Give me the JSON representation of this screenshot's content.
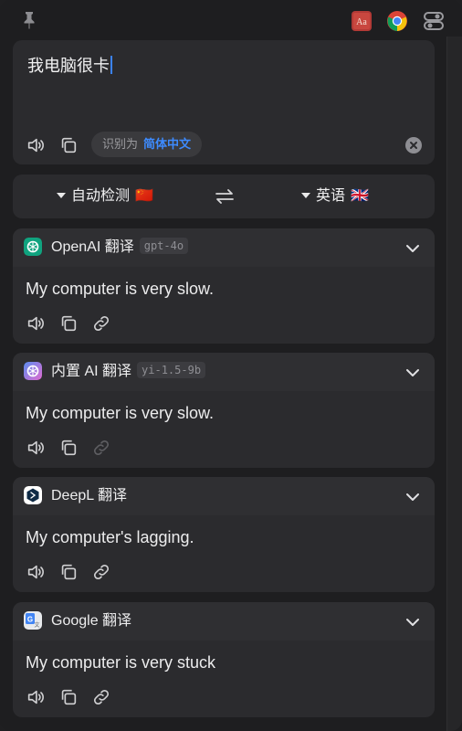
{
  "toolbar": {
    "pin_icon": "pin-icon",
    "dictionary_icon": "dictionary-app-icon",
    "chrome_icon": "chrome-browser-icon",
    "settings_icon": "toggle-settings-icon"
  },
  "input": {
    "text": "我电脑很卡",
    "detected_prefix": "识别为",
    "detected_language": "简体中文"
  },
  "languages": {
    "source": "自动检测",
    "source_flag": "🇨🇳",
    "target": "英语",
    "target_flag": "🇬🇧"
  },
  "results": [
    {
      "service": "OpenAI 翻译",
      "model": "gpt-4o",
      "text": "My computer is very slow.",
      "logo_color": "#10a37f",
      "link_enabled": true
    },
    {
      "service": "内置 AI 翻译",
      "model": "yi-1.5-9b",
      "text": "My computer is very slow.",
      "logo_color": "#a06cf0",
      "link_enabled": false
    },
    {
      "service": "DeepL 翻译",
      "model": "",
      "text": "My computer's lagging.",
      "logo_color": "#0f2b46",
      "link_enabled": true
    },
    {
      "service": "Google 翻译",
      "model": "",
      "text": "My computer is very stuck",
      "logo_color": "#4285f4",
      "link_enabled": true
    }
  ],
  "colors": {
    "accent": "#3d8bff",
    "panel": "#2b2b2e",
    "background": "#1e1e20"
  }
}
